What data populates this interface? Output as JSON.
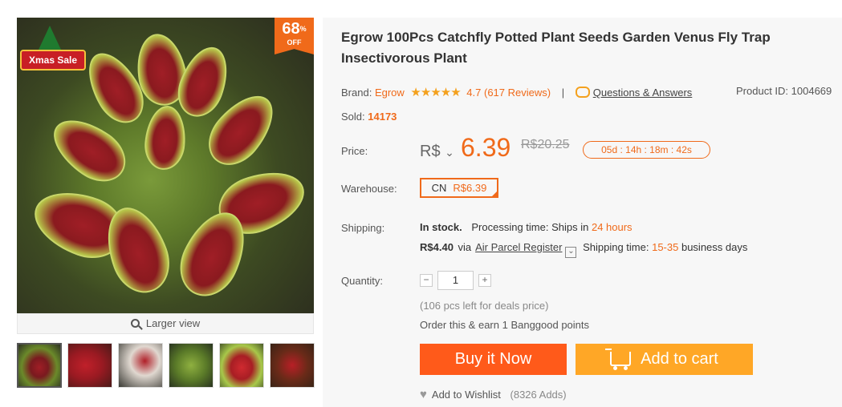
{
  "gallery": {
    "badge_text": "Xmas Sale",
    "discount_pct": "68",
    "discount_pct_sign": "%",
    "discount_off": "OFF",
    "larger_view": "Larger view"
  },
  "product": {
    "title": "Egrow 100Pcs Catchfly Potted Plant Seeds Garden Venus Fly Trap Insectivorous Plant",
    "brand_label": "Brand:",
    "brand": "Egrow",
    "stars": "★★★★★",
    "rating": "4.7",
    "reviews": "(617 Reviews)",
    "separator": "|",
    "qa_link": "Questions & Answers",
    "product_id_label": "Product ID:",
    "product_id": "1004669",
    "sold_label": "Sold:",
    "sold": "14173"
  },
  "price": {
    "label": "Price:",
    "currency": "R$",
    "currency_caret": "⌄",
    "value": "6.39",
    "old": "R$20.25",
    "timer": "05d : 14h : 18m : 42s"
  },
  "warehouse": {
    "label": "Warehouse:",
    "code": "CN",
    "price": "R$6.39"
  },
  "shipping": {
    "label": "Shipping:",
    "stock": "In stock.",
    "processing_label": "Processing time:",
    "processing_prefix": "Ships in",
    "processing_value": "24 hours",
    "cost": "R$4.40",
    "via": "via",
    "method": "Air Parcel Register",
    "dropdown_glyph": "⌄",
    "time_label": "Shipping time:",
    "time_value": "15-35",
    "time_unit": "business days"
  },
  "quantity": {
    "label": "Quantity:",
    "minus": "−",
    "value": "1",
    "plus": "+",
    "deals_note": "(106 pcs left for deals price)",
    "points_note": "Order this & earn 1 Banggood points"
  },
  "actions": {
    "buy_now": "Buy it Now",
    "add_to_cart": "Add to cart",
    "wishlist": "Add to Wishlist",
    "wishlist_count": "(8326 Adds)"
  },
  "colors": {
    "accent": "#f06a1a",
    "buy": "#ff5a1a",
    "cart": "#ffa726"
  }
}
